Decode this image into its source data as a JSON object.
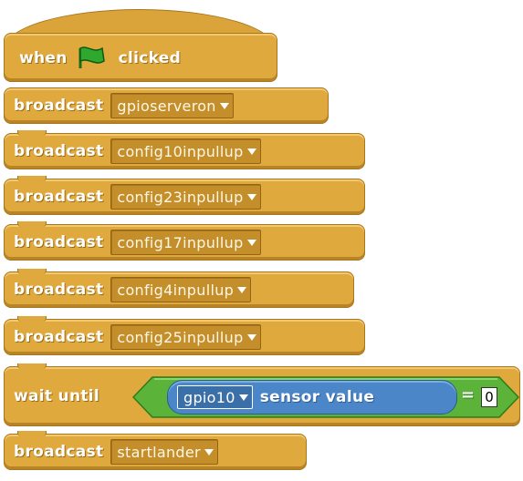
{
  "hat": {
    "when_label": "when",
    "clicked_label": "clicked",
    "flag_icon": "green-flag-icon"
  },
  "blocks": [
    {
      "label": "broadcast",
      "message": "gpioserveron"
    },
    {
      "label": "broadcast",
      "message": "config10inpullup"
    },
    {
      "label": "broadcast",
      "message": "config23inpullup"
    },
    {
      "label": "broadcast",
      "message": "config17inpullup"
    },
    {
      "label": "broadcast",
      "message": "config4inpullup"
    },
    {
      "label": "broadcast",
      "message": "config25inpullup"
    }
  ],
  "wait": {
    "label": "wait until",
    "sensor_name": "gpio10",
    "sensor_label": "sensor value",
    "operator": "=",
    "value": "0"
  },
  "final_block": {
    "label": "broadcast",
    "message": "startlander"
  },
  "colors": {
    "control": "#e0a93e",
    "sensing": "#4a86c8",
    "operators": "#5cb33a",
    "flag": "#2ea82e"
  }
}
